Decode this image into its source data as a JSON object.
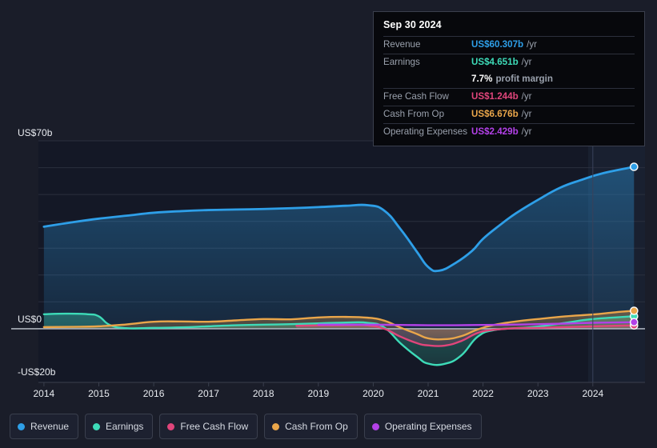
{
  "theme": {
    "background": "#1a1d29",
    "plot_background": "#141826",
    "gridline": "#2a2f3e",
    "axis_line": "#9aa1ad",
    "text": "#e9ecf1",
    "muted_text": "#9aa1ad"
  },
  "tooltip": {
    "date": "Sep 30 2024",
    "rows": [
      {
        "label": "Revenue",
        "value": "US$60.307b",
        "unit": "/yr",
        "color": "#2e9fe8"
      },
      {
        "label": "Earnings",
        "value": "US$4.651b",
        "unit": "/yr",
        "color": "#3ddbb8"
      },
      {
        "label": "Free Cash Flow",
        "value": "US$1.244b",
        "unit": "/yr",
        "color": "#e0457b"
      },
      {
        "label": "Cash From Op",
        "value": "US$6.676b",
        "unit": "/yr",
        "color": "#eaa64a"
      },
      {
        "label": "Operating Expenses",
        "value": "US$2.429b",
        "unit": "/yr",
        "color": "#b341e8"
      }
    ],
    "margin": {
      "value": "7.7%",
      "text": "profit margin"
    }
  },
  "axes": {
    "y_top_label": "US$70b",
    "y_zero_label": "US$0",
    "y_bottom_label": "-US$20b",
    "x_ticks": [
      "2014",
      "2015",
      "2016",
      "2017",
      "2018",
      "2019",
      "2020",
      "2021",
      "2022",
      "2023",
      "2024"
    ]
  },
  "legend": [
    {
      "label": "Revenue",
      "color": "#2e9fe8"
    },
    {
      "label": "Earnings",
      "color": "#3ddbb8"
    },
    {
      "label": "Free Cash Flow",
      "color": "#e0457b"
    },
    {
      "label": "Cash From Op",
      "color": "#eaa64a"
    },
    {
      "label": "Operating Expenses",
      "color": "#b341e8"
    }
  ],
  "chart_data": {
    "type": "line",
    "title": "",
    "xlabel": "",
    "ylabel": "US$",
    "ylim": [
      -20,
      70
    ],
    "xlim": [
      2013.9,
      2024.95
    ],
    "grid": true,
    "legend_position": "bottom",
    "units": "US$ billions per year (trailing twelve months)",
    "gridline_values": [
      70,
      60,
      50,
      40,
      30,
      20,
      10,
      0,
      -20
    ],
    "forecast_divider_x": 2024.0,
    "end_marker_date": "Sep 30 2024",
    "series": [
      {
        "name": "Revenue",
        "color": "#2e9fe8",
        "fill": true,
        "x": [
          2014.0,
          2014.5,
          2015.0,
          2015.5,
          2016.0,
          2016.5,
          2017.0,
          2017.5,
          2018.0,
          2018.5,
          2019.0,
          2019.5,
          2019.9,
          2020.2,
          2020.5,
          2020.8,
          2021.0,
          2021.2,
          2021.5,
          2021.8,
          2022.0,
          2022.3,
          2022.6,
          2023.0,
          2023.4,
          2023.8,
          2024.2,
          2024.75
        ],
        "y": [
          38.0,
          39.6,
          41.0,
          42.1,
          43.2,
          43.8,
          44.2,
          44.4,
          44.6,
          44.9,
          45.3,
          45.8,
          46.0,
          44.0,
          37.0,
          28.5,
          23.0,
          21.6,
          24.5,
          29.0,
          33.5,
          38.5,
          43.0,
          48.0,
          52.5,
          55.5,
          58.0,
          60.307
        ]
      },
      {
        "name": "Earnings",
        "color": "#3ddbb8",
        "fill": true,
        "x": [
          2014.0,
          2014.4,
          2014.8,
          2015.0,
          2015.2,
          2015.5,
          2016.0,
          2016.5,
          2017.0,
          2017.5,
          2018.0,
          2018.5,
          2019.0,
          2019.5,
          2019.9,
          2020.2,
          2020.5,
          2020.8,
          2021.0,
          2021.3,
          2021.6,
          2021.9,
          2022.2,
          2022.6,
          2023.0,
          2023.5,
          2024.0,
          2024.75
        ],
        "y": [
          5.4,
          5.6,
          5.4,
          4.6,
          1.4,
          0.2,
          0.3,
          0.5,
          0.9,
          1.3,
          1.5,
          1.7,
          2.0,
          2.3,
          2.2,
          0.5,
          -5.5,
          -10.5,
          -13.0,
          -13.1,
          -10.0,
          -3.0,
          -0.5,
          0.2,
          0.8,
          2.2,
          3.6,
          4.651
        ]
      },
      {
        "name": "Free Cash Flow",
        "color": "#e0457b",
        "fill": true,
        "x": [
          2018.6,
          2019.0,
          2019.5,
          2019.9,
          2020.2,
          2020.5,
          2020.8,
          2021.0,
          2021.3,
          2021.6,
          2021.9,
          2022.2,
          2022.6,
          2023.0,
          2023.5,
          2024.0,
          2024.75
        ],
        "y": [
          1.1,
          1.2,
          1.3,
          1.2,
          0.0,
          -3.0,
          -5.4,
          -6.2,
          -6.3,
          -4.6,
          -1.6,
          -0.4,
          0.2,
          0.3,
          0.6,
          0.9,
          1.244
        ]
      },
      {
        "name": "Cash From Op",
        "color": "#eaa64a",
        "fill": true,
        "x": [
          2014.0,
          2014.5,
          2015.0,
          2015.5,
          2016.0,
          2016.5,
          2017.0,
          2017.5,
          2018.0,
          2018.5,
          2019.0,
          2019.5,
          2019.9,
          2020.2,
          2020.5,
          2020.8,
          2021.0,
          2021.3,
          2021.6,
          2021.9,
          2022.2,
          2022.6,
          2023.0,
          2023.5,
          2024.0,
          2024.4,
          2024.75
        ],
        "y": [
          0.6,
          0.7,
          0.9,
          1.6,
          2.6,
          2.7,
          2.6,
          3.1,
          3.6,
          3.5,
          4.2,
          4.4,
          4.1,
          3.0,
          0.4,
          -2.0,
          -3.6,
          -3.9,
          -2.8,
          -0.3,
          1.4,
          2.7,
          3.6,
          4.6,
          5.3,
          6.1,
          6.676
        ]
      },
      {
        "name": "Operating Expenses",
        "color": "#b341e8",
        "fill": false,
        "x": [
          2019.0,
          2019.5,
          2020.0,
          2020.5,
          2021.0,
          2021.5,
          2022.0,
          2022.5,
          2023.0,
          2023.5,
          2024.0,
          2024.75
        ],
        "y": [
          1.5,
          1.5,
          1.5,
          1.4,
          1.3,
          1.3,
          1.4,
          1.5,
          1.7,
          1.9,
          2.2,
          2.429
        ]
      }
    ]
  }
}
